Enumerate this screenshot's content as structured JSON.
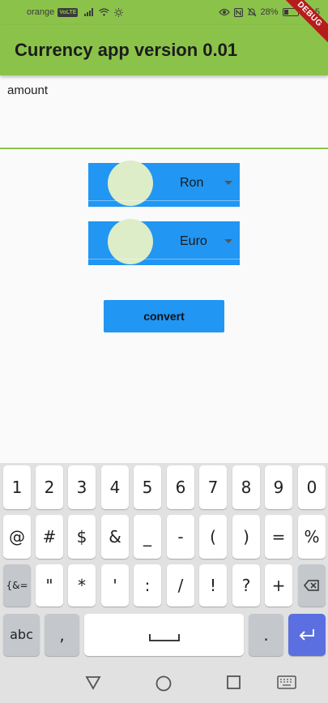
{
  "status_bar": {
    "carrier": "orange",
    "network_badge": "VoLTE",
    "battery": "28%",
    "time": "10:5"
  },
  "debug_banner": "DEBUG",
  "app_bar": {
    "title": "Currency app version 0.01"
  },
  "amount": {
    "label": "amount"
  },
  "from_dropdown": {
    "value": "Ron"
  },
  "to_dropdown": {
    "value": "Euro"
  },
  "convert_button": {
    "label": "convert"
  },
  "keyboard": {
    "row1": [
      "1",
      "2",
      "3",
      "4",
      "5",
      "6",
      "7",
      "8",
      "9",
      "0"
    ],
    "row2": [
      "@",
      "#",
      "$",
      "&",
      "_",
      "-",
      "(",
      ")",
      "=",
      "%"
    ],
    "row3": [
      "{&=",
      "\"",
      "*",
      "'",
      ":",
      "/",
      "!",
      "?",
      "+"
    ],
    "row4": {
      "abc": "abc",
      "comma": ",",
      "period": "."
    }
  },
  "colors": {
    "primary": "#8bc34a",
    "accent": "#2196f3",
    "enter": "#5b6fe0"
  }
}
